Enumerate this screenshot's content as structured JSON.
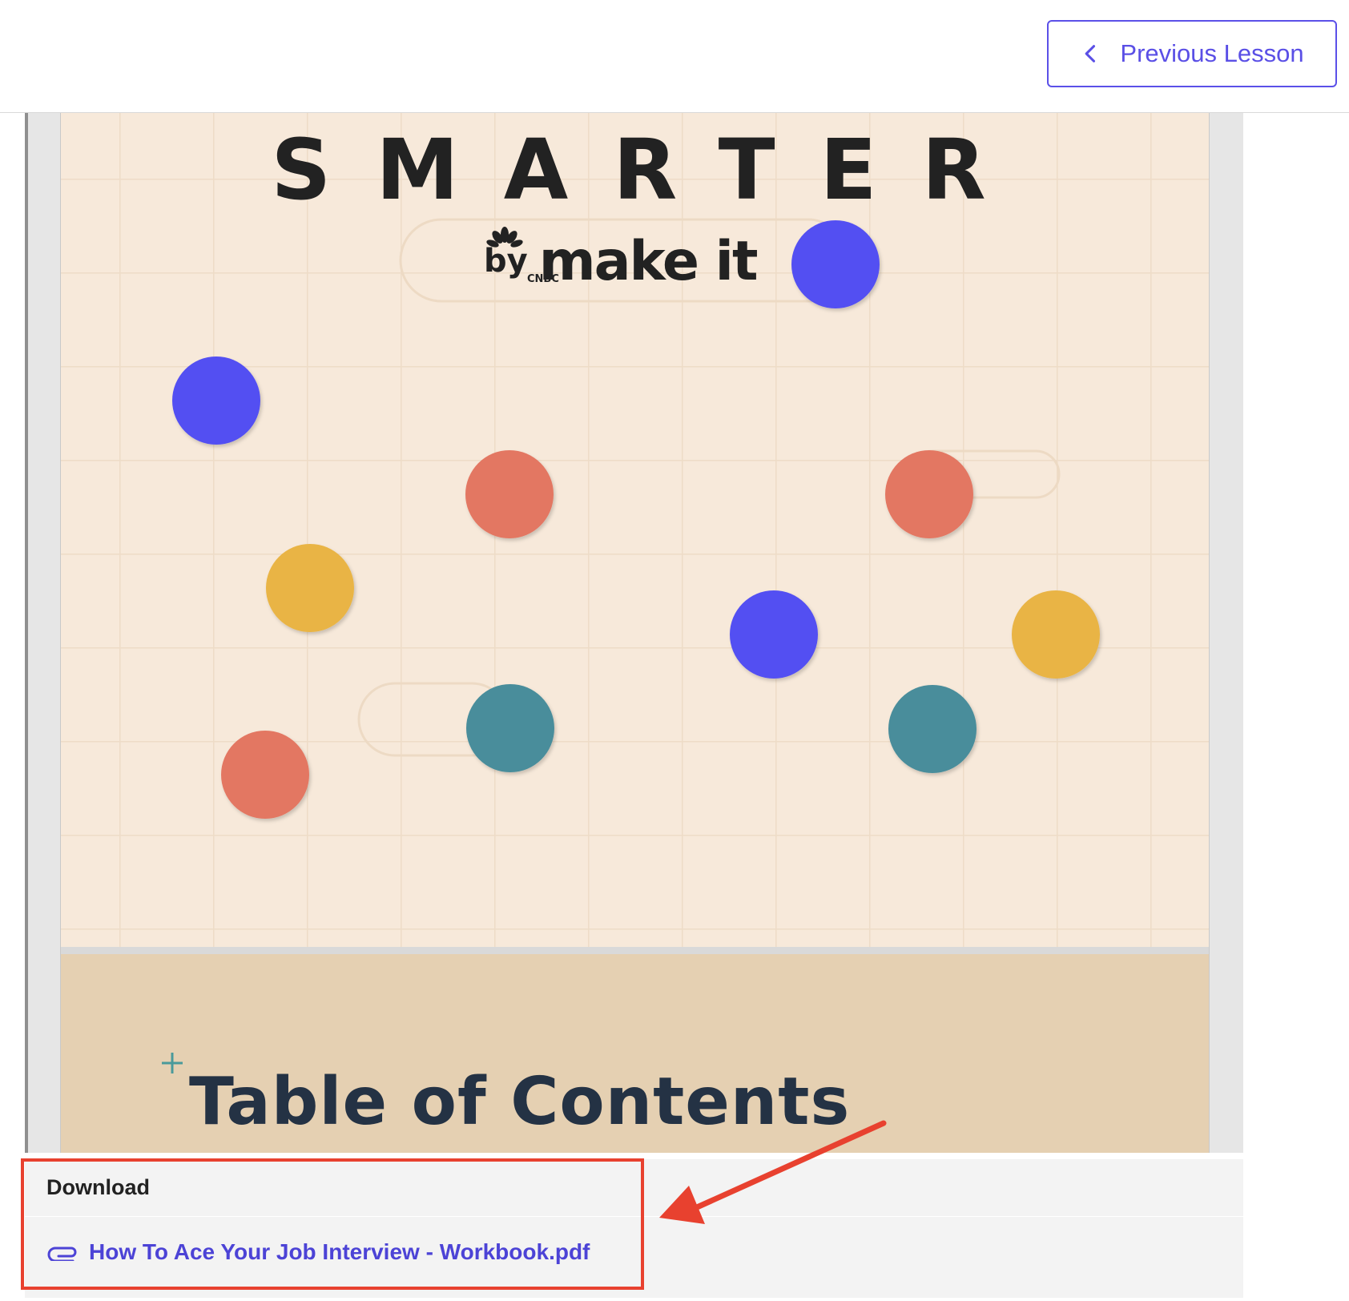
{
  "header": {
    "previous_lesson_label": "Previous Lesson",
    "accent_color": "#5a4fe6"
  },
  "pdf": {
    "brand_title": "SMARTER",
    "brand_by": "by",
    "brand_network": "CNBC",
    "brand_name": "make it",
    "toc_title": "Table of Contents",
    "cover_dots": [
      {
        "color": "blue"
      },
      {
        "color": "blue"
      },
      {
        "color": "coral"
      },
      {
        "color": "coral"
      },
      {
        "color": "yellow"
      },
      {
        "color": "blue"
      },
      {
        "color": "yellow"
      },
      {
        "color": "teal"
      },
      {
        "color": "teal"
      },
      {
        "color": "coral"
      }
    ],
    "colors": {
      "blue": "#5350f2",
      "coral": "#e37762",
      "yellow": "#e9b444",
      "teal": "#4a8d9b",
      "background": "#f7e9da",
      "footer": "#e5d0b2"
    }
  },
  "downloads": {
    "header": "Download",
    "file_name": "How To Ace Your Job Interview - Workbook.pdf"
  },
  "annotation": {
    "highlight_color": "#e8412f"
  }
}
